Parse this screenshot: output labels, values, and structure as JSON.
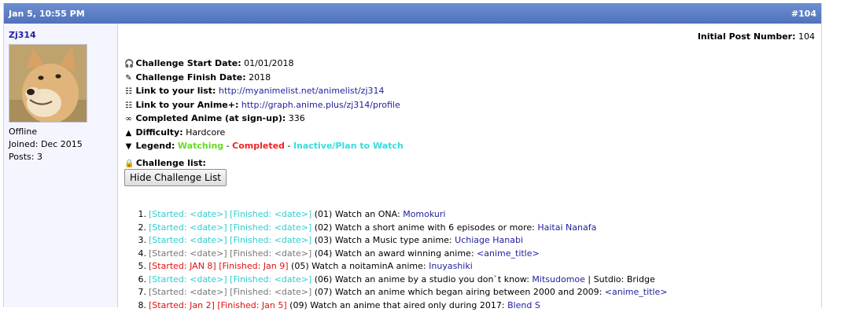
{
  "header": {
    "date": "Jan 5, 10:55 PM",
    "post_ref": "#104"
  },
  "user": {
    "name": "Zj314",
    "status": "Offline",
    "joined": "Joined: Dec 2015",
    "posts": "Posts: 3"
  },
  "post": {
    "initial_label": "Initial Post Number:",
    "initial_value": "104",
    "fields": {
      "start_label": "Challenge Start Date:",
      "start_value": "01/01/2018",
      "finish_label": "Challenge Finish Date:",
      "finish_value": "2018",
      "list_label": "Link to your list:",
      "list_value": "http://myanimelist.net/animelist/zj314",
      "animeplus_label": "Link to your Anime+:",
      "animeplus_value": "http://graph.anime.plus/zj314/profile",
      "completed_label": "Completed Anime (at sign-up):",
      "completed_value": "336",
      "difficulty_label": "Difficulty:",
      "difficulty_value": "Hardcore",
      "legend_label": "Legend:",
      "legend_watching": "Watching",
      "legend_sep1": " - ",
      "legend_completed": "Completed",
      "legend_sep2": " - ",
      "legend_inactive": "Inactive/Plan to Watch"
    },
    "challenge_list_label": "Challenge list:",
    "hide_button": "Hide Challenge List",
    "items": [
      {
        "n": "1.",
        "started": "[Started: <date>]",
        "finished": "[Finished: <date>]",
        "text": "(01) Watch an ONA:",
        "title": "Momokuri",
        "after": ""
      },
      {
        "n": "2.",
        "started": "[Started: <date>]",
        "finished": "[Finished: <date>]",
        "text": "(02) Watch a short anime with 6 episodes or more:",
        "title": "Haitai Nanafa",
        "after": ""
      },
      {
        "n": "3.",
        "started": "[Started: <date>]",
        "finished": "[Finished: <date>]",
        "text": "(03) Watch a Music type anime:",
        "title": "Uchiage Hanabi",
        "after": ""
      },
      {
        "n": "4.",
        "started": "[Started: <date>]",
        "finished": "[Finished: <date>]",
        "text": "(04) Watch an award winning anime:",
        "title": "<anime_title>",
        "after": ""
      },
      {
        "n": "5.",
        "started": "[Started: JAN 8]",
        "finished": "[Finished: Jan 9]",
        "text": "(05) Watch a noitaminA anime:",
        "title": "Inuyashiki",
        "after": ""
      },
      {
        "n": "6.",
        "started": "[Started: <date>]",
        "finished": "[Finished: <date>]",
        "text": "(06) Watch an anime by a studio you don`t know:",
        "title": "Mitsudomoe",
        "after": " | Sutdio: Bridge"
      },
      {
        "n": "7.",
        "started": "[Started: <date>]",
        "finished": "[Finished: <date>]",
        "text": "(07) Watch an anime which began airing between 2000 and 2009:",
        "title": "<anime_title>",
        "after": ""
      },
      {
        "n": "8.",
        "started": "[Started: Jan 2]",
        "finished": "[Finished: Jan 5]",
        "text": "(09) Watch an anime that aired only during 2017:",
        "title": "Blend S",
        "after": ""
      }
    ]
  },
  "colors": {
    "header": "#5c7ec2",
    "watching": "#66dd22",
    "completed": "#ee2222",
    "inactive": "#33dddd",
    "link": "#22229c"
  }
}
